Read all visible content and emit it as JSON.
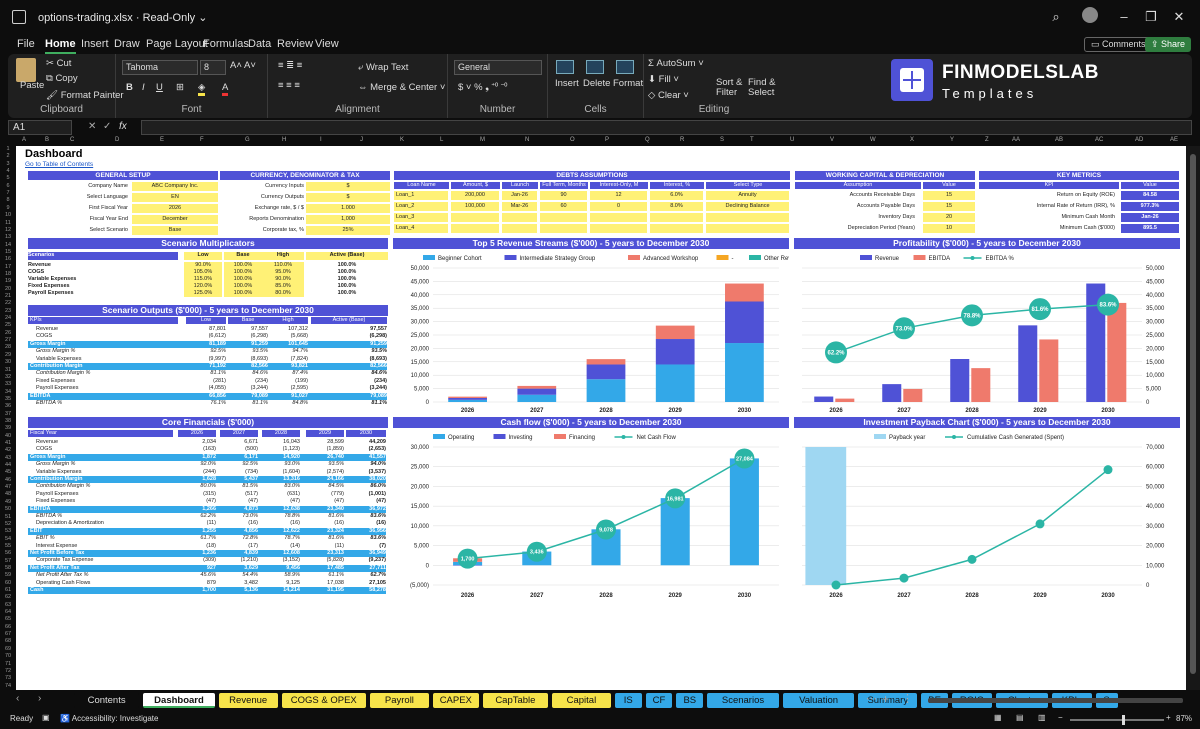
{
  "window": {
    "filename": "options-trading.xlsx",
    "mode": "Read-Only"
  },
  "menu": [
    "File",
    "Home",
    "Insert",
    "Draw",
    "Page Layout",
    "Formulas",
    "Data",
    "Review",
    "View"
  ],
  "menu_active": "Home",
  "buttons": {
    "comments": "Comments",
    "share": "Share"
  },
  "ribbon": {
    "clipboard": {
      "paste": "Paste",
      "cut": "Cut",
      "copy": "Copy",
      "format_painter": "Format Painter",
      "label": "Clipboard"
    },
    "font": {
      "name": "Tahoma",
      "size": "8",
      "label": "Font"
    },
    "alignment": {
      "wrap": "Wrap Text",
      "merge": "Merge & Center",
      "label": "Alignment"
    },
    "number": {
      "format": "General",
      "label": "Number"
    },
    "cells": {
      "insert": "Insert",
      "delete": "Delete",
      "format": "Format",
      "label": "Cells"
    },
    "editing": {
      "autosum": "AutoSum",
      "fill": "Fill",
      "clear": "Clear",
      "sort": "Sort & Filter",
      "find": "Find & Select",
      "label": "Editing"
    },
    "logo": {
      "line1": "FINMODELSLAB",
      "line2": "Templates"
    }
  },
  "formula_bar": {
    "cell": "A1",
    "fx": "fx"
  },
  "columns": [
    "A",
    "B",
    "C",
    "D",
    "E",
    "F",
    "G",
    "H",
    "I",
    "J",
    "K",
    "L",
    "M",
    "N",
    "O",
    "P",
    "Q",
    "R",
    "S",
    "T",
    "U",
    "V",
    "W",
    "X",
    "Y",
    "Z",
    "AA",
    "AB",
    "AC",
    "AD",
    "AE"
  ],
  "sheet": {
    "title": "Dashboard",
    "toc": "Go to Table of Contents",
    "general_setup": {
      "title": "GENERAL SETUP",
      "rows": [
        [
          "Company Name",
          "ABC Company Inc."
        ],
        [
          "Select Language",
          "EN"
        ],
        [
          "First Fiscal Year",
          "2026"
        ],
        [
          "Fiscal Year End",
          "December"
        ],
        [
          "Select Scenario",
          "Base"
        ]
      ]
    },
    "currency": {
      "title": "CURRENCY, DENOMINATOR & TAX",
      "rows": [
        [
          "Currency Inputs",
          "$"
        ],
        [
          "Currency Outputs",
          "$"
        ],
        [
          "Exchange rate, $ / $",
          "1.000"
        ],
        [
          "Reports Denomination",
          "1,000"
        ],
        [
          "Corporate tax, %",
          "25%"
        ]
      ]
    },
    "debts": {
      "title": "DEBTS ASSUMPTIONS",
      "headers": [
        "Loan Name",
        "Amount, $",
        "Launch",
        "Full Term, Months",
        "Interest-Only, M",
        "Interest, %",
        "Select Type"
      ],
      "rows": [
        [
          "Loan_1",
          "200,000",
          "Jan-26",
          "90",
          "12",
          "6.0%",
          "Annuity"
        ],
        [
          "Loan_2",
          "100,000",
          "Mar-26",
          "60",
          "0",
          "8.0%",
          "Declining Balance"
        ],
        [
          "Loan_3",
          "",
          "",
          "",
          "",
          "",
          ""
        ],
        [
          "Loan_4",
          "",
          "",
          "",
          "",
          "",
          ""
        ]
      ]
    },
    "working_capital": {
      "title": "WORKING CAPITAL & DEPRECIATION",
      "headers": [
        "Assumption",
        "Value"
      ],
      "rows": [
        [
          "Accounts Receivable Days",
          "15"
        ],
        [
          "Accounts Payable Days",
          "15"
        ],
        [
          "Inventory Days",
          "20"
        ],
        [
          "Depreciation Period (Years)",
          "10"
        ]
      ]
    },
    "key_metrics": {
      "title": "KEY METRICS",
      "headers": [
        "KPI",
        "Value"
      ],
      "rows": [
        [
          "Return on Equity (ROE)",
          "84.58"
        ],
        [
          "Internal Rate of Return (IRR), %",
          "977.3%"
        ],
        [
          "Minimum Cash Month",
          "Jan-26"
        ],
        [
          "Minimum Cash ($'000)",
          "895.5"
        ]
      ]
    },
    "scenario_multipliers": {
      "title": "Scenario Multiplicators",
      "headers": [
        "Scenarios",
        "Low",
        "Base",
        "High",
        "Active (Base)"
      ],
      "rows": [
        [
          "Revenue",
          "90.0%",
          "100.0%",
          "110.0%",
          "100.0%"
        ],
        [
          "COGS",
          "105.0%",
          "100.0%",
          "95.0%",
          "100.0%"
        ],
        [
          "Variable Expenses",
          "115.0%",
          "100.0%",
          "90.0%",
          "100.0%"
        ],
        [
          "Fixed Expenses",
          "120.0%",
          "100.0%",
          "85.0%",
          "100.0%"
        ],
        [
          "Payroll Expenses",
          "125.0%",
          "100.0%",
          "80.0%",
          "100.0%"
        ]
      ]
    },
    "scenario_outputs": {
      "title": "Scenario Outputs ($'000) - 5 years to December 2030",
      "headers": [
        "KPIs",
        "Low",
        "Base",
        "High",
        "Active (Base)"
      ],
      "rows": [
        [
          "Revenue",
          "87,801",
          "97,557",
          "107,312",
          "97,557",
          ""
        ],
        [
          "COGS",
          "(6,612)",
          "(6,298)",
          "(5,668)",
          "(6,298)",
          ""
        ],
        [
          "Gross Margin",
          "81,189",
          "91,259",
          "101,645",
          "91,259",
          "h"
        ],
        [
          "Gross Margin %",
          "92.5%",
          "93.5%",
          "94.7%",
          "93.5%",
          "i"
        ],
        [
          "Variable Expenses",
          "(9,997)",
          "(8,693)",
          "(7,824)",
          "(8,693)",
          ""
        ],
        [
          "Contribution Margin",
          "71,192",
          "82,566",
          "93,821",
          "82,566",
          "h"
        ],
        [
          "Contribution Margin %",
          "81.1%",
          "84.6%",
          "87.4%",
          "84.6%",
          "i"
        ],
        [
          "Fixed Expenses",
          "(281)",
          "(234)",
          "(199)",
          "(234)",
          ""
        ],
        [
          "Payroll Expenses",
          "(4,055)",
          "(3,244)",
          "(2,595)",
          "(3,244)",
          ""
        ],
        [
          "EBITDA",
          "66,856",
          "79,089",
          "91,027",
          "79,089",
          "h"
        ],
        [
          "EBITDA %",
          "76.1%",
          "81.1%",
          "84.8%",
          "81.1%",
          "i"
        ]
      ]
    },
    "core_financials": {
      "title": "Core Financials ($'000)",
      "headers": [
        "Fiscal Year",
        "2026",
        "2027",
        "2028",
        "2029",
        "2030"
      ],
      "rows": [
        [
          "Revenue",
          "2,034",
          "6,671",
          "16,043",
          "28,599",
          "44,209",
          ""
        ],
        [
          "COGS",
          "(163)",
          "(500)",
          "(1,123)",
          "(1,859)",
          "(2,653)",
          ""
        ],
        [
          "Gross Margin",
          "1,872",
          "6,171",
          "14,920",
          "26,740",
          "41,557",
          "h"
        ],
        [
          "Gross Margin %",
          "92.0%",
          "92.5%",
          "93.0%",
          "93.5%",
          "94.0%",
          "i"
        ],
        [
          "Variable Expenses",
          "(244)",
          "(734)",
          "(1,604)",
          "(2,574)",
          "(3,537)",
          ""
        ],
        [
          "Contribution Margin",
          "1,628",
          "5,437",
          "13,316",
          "24,166",
          "38,020",
          "h"
        ],
        [
          "Contribution Margin %",
          "80.0%",
          "81.5%",
          "83.0%",
          "84.5%",
          "86.0%",
          "i"
        ],
        [
          "Payroll Expenses",
          "(315)",
          "(517)",
          "(631)",
          "(779)",
          "(1,001)",
          ""
        ],
        [
          "Fixed Expenses",
          "(47)",
          "(47)",
          "(47)",
          "(47)",
          "(47)",
          ""
        ],
        [
          "EBITDA",
          "1,266",
          "4,873",
          "12,638",
          "23,340",
          "36,972",
          "h"
        ],
        [
          "EBITDA %",
          "62.2%",
          "73.0%",
          "78.8%",
          "81.6%",
          "83.6%",
          "i"
        ],
        [
          "Depreciation & Amortization",
          "(11)",
          "(16)",
          "(16)",
          "(16)",
          "(16)",
          ""
        ],
        [
          "EBIT",
          "1,255",
          "4,856",
          "12,622",
          "23,324",
          "36,956",
          "h"
        ],
        [
          "EBIT %",
          "61.7%",
          "72.8%",
          "78.7%",
          "81.6%",
          "83.6%",
          "i"
        ],
        [
          "Interest Expense",
          "(18)",
          "(17)",
          "(14)",
          "(11)",
          "(7)",
          ""
        ],
        [
          "Net Profit Before Tax",
          "1,236",
          "4,839",
          "12,608",
          "23,313",
          "36,949",
          "h"
        ],
        [
          "Corporate Tax Expense",
          "(309)",
          "(1,210)",
          "(3,152)",
          "(5,828)",
          "(9,237)",
          ""
        ],
        [
          "Net Profit After Tax",
          "927",
          "3,629",
          "9,456",
          "17,485",
          "27,711",
          "h"
        ],
        [
          "Net Profit After Tax %",
          "45.6%",
          "54.4%",
          "58.9%",
          "61.1%",
          "62.7%",
          "i"
        ],
        [
          "Operating Cash Flows",
          "879",
          "3,482",
          "9,125",
          "17,038",
          "27,105",
          ""
        ],
        [
          "Cash",
          "1,700",
          "5,136",
          "14,214",
          "31,195",
          "58,278",
          "h"
        ]
      ]
    },
    "chart_titles": {
      "revenue": "Top 5 Revenue Streams ($'000) - 5 years to December 2030",
      "profit": "Profitability ($'000) - 5 years to December 2030",
      "cash": "Cash flow ($'000) - 5 years to December 2030",
      "payback": "Investment Payback Chart ($'000) - 5 years to December 2030"
    }
  },
  "chart_data": [
    {
      "type": "bar",
      "stacked": true,
      "title": "Top 5 Revenue Streams ($'000) - 5 years to December 2030",
      "categories": [
        "2026",
        "2027",
        "2028",
        "2029",
        "2030"
      ],
      "ylim": [
        0,
        50000
      ],
      "series": [
        {
          "name": "Beginner Cohort",
          "color": "#33a8e8",
          "values": [
            800,
            2700,
            8500,
            14000,
            22000
          ]
        },
        {
          "name": "Intermediate Strategy Group",
          "color": "#4f52d6",
          "values": [
            700,
            2300,
            5500,
            9500,
            15500
          ]
        },
        {
          "name": "Advanced Workshop",
          "color": "#ef7a6c",
          "values": [
            500,
            1000,
            2000,
            5000,
            6700
          ]
        },
        {
          "name": "-",
          "color": "#f5a623",
          "values": [
            0,
            0,
            0,
            0,
            0
          ]
        },
        {
          "name": "Other Revenue",
          "color": "#2bb5a5",
          "values": [
            0,
            0,
            0,
            0,
            0
          ]
        }
      ]
    },
    {
      "type": "bar+line",
      "title": "Profitability ($'000) - 5 years to December 2030",
      "categories": [
        "2026",
        "2027",
        "2028",
        "2029",
        "2030"
      ],
      "ylim": [
        0,
        50000
      ],
      "series": [
        {
          "name": "Revenue",
          "color": "#4f52d6",
          "values": [
            2034,
            6671,
            16043,
            28599,
            44209
          ]
        },
        {
          "name": "EBITDA",
          "color": "#ef7a6c",
          "values": [
            1266,
            4873,
            12638,
            23340,
            36972
          ]
        },
        {
          "name": "EBITDA %",
          "color": "#2bb5a5",
          "values": [
            62.2,
            73.0,
            78.8,
            81.6,
            83.6
          ],
          "labels": [
            "62.2%",
            "73.0%",
            "78.8%",
            "81.6%",
            "83.6%"
          ]
        }
      ]
    },
    {
      "type": "bar+line",
      "title": "Cash flow ($'000) - 5 years to December 2030",
      "categories": [
        "2026",
        "2027",
        "2028",
        "2029",
        "2030"
      ],
      "ylim": [
        -5000,
        30000
      ],
      "series": [
        {
          "name": "Operating",
          "color": "#33a8e8",
          "values": [
            879,
            3482,
            9125,
            17038,
            27105
          ]
        },
        {
          "name": "Investing",
          "color": "#4f52d6",
          "values": [
            -100,
            0,
            0,
            0,
            0
          ]
        },
        {
          "name": "Financing",
          "color": "#ef7a6c",
          "values": [
            900,
            0,
            0,
            0,
            0
          ]
        },
        {
          "name": "Net Cash Flow",
          "color": "#2bb5a5",
          "values": [
            1700,
            3436,
            9078,
            16981,
            27084
          ],
          "labels": [
            "1,700",
            "3,436",
            "9,078",
            "16,981",
            "27,084"
          ]
        }
      ]
    },
    {
      "type": "bar+line",
      "title": "Investment Payback Chart ($'000) - 5 years to December 2030",
      "categories": [
        "2026",
        "2027",
        "2028",
        "2029",
        "2030"
      ],
      "ylim": [
        0,
        70000
      ],
      "series": [
        {
          "name": "Payback year",
          "color": "#9fd7f2",
          "values": [
            70000,
            0,
            0,
            0,
            0
          ]
        },
        {
          "name": "Cumulative Cash Generated (Spent)",
          "color": "#2bb5a5",
          "values": [
            0,
            3500,
            13000,
            31000,
            58500
          ]
        }
      ]
    }
  ],
  "tabs": [
    {
      "label": "Contents",
      "color": "#0d0d0d",
      "text": "#ddd"
    },
    {
      "label": "Dashboard",
      "color": "#ffffff",
      "text": "#111",
      "active": true
    },
    {
      "label": "Revenue",
      "color": "#f7e34a"
    },
    {
      "label": "COGS & OPEX",
      "color": "#f7e34a"
    },
    {
      "label": "Payroll",
      "color": "#f7e34a"
    },
    {
      "label": "CAPEX",
      "color": "#f7e34a"
    },
    {
      "label": "CapTable",
      "color": "#f7e34a"
    },
    {
      "label": "Capital",
      "color": "#f7e34a"
    },
    {
      "label": "IS",
      "color": "#33a8e8"
    },
    {
      "label": "CF",
      "color": "#33a8e8"
    },
    {
      "label": "BS",
      "color": "#33a8e8"
    },
    {
      "label": "Scenarios",
      "color": "#33a8e8"
    },
    {
      "label": "Valuation",
      "color": "#33a8e8"
    },
    {
      "label": "Summary",
      "color": "#33a8e8"
    },
    {
      "label": "BE",
      "color": "#33a8e8"
    },
    {
      "label": "ROIC",
      "color": "#33a8e8"
    },
    {
      "label": "Charts",
      "color": "#33a8e8"
    },
    {
      "label": "KPIs",
      "color": "#33a8e8"
    },
    {
      "label": "S",
      "color": "#33a8e8"
    }
  ],
  "status": {
    "ready": "Ready",
    "accessibility": "Accessibility: Investigate",
    "zoom": "87%"
  }
}
